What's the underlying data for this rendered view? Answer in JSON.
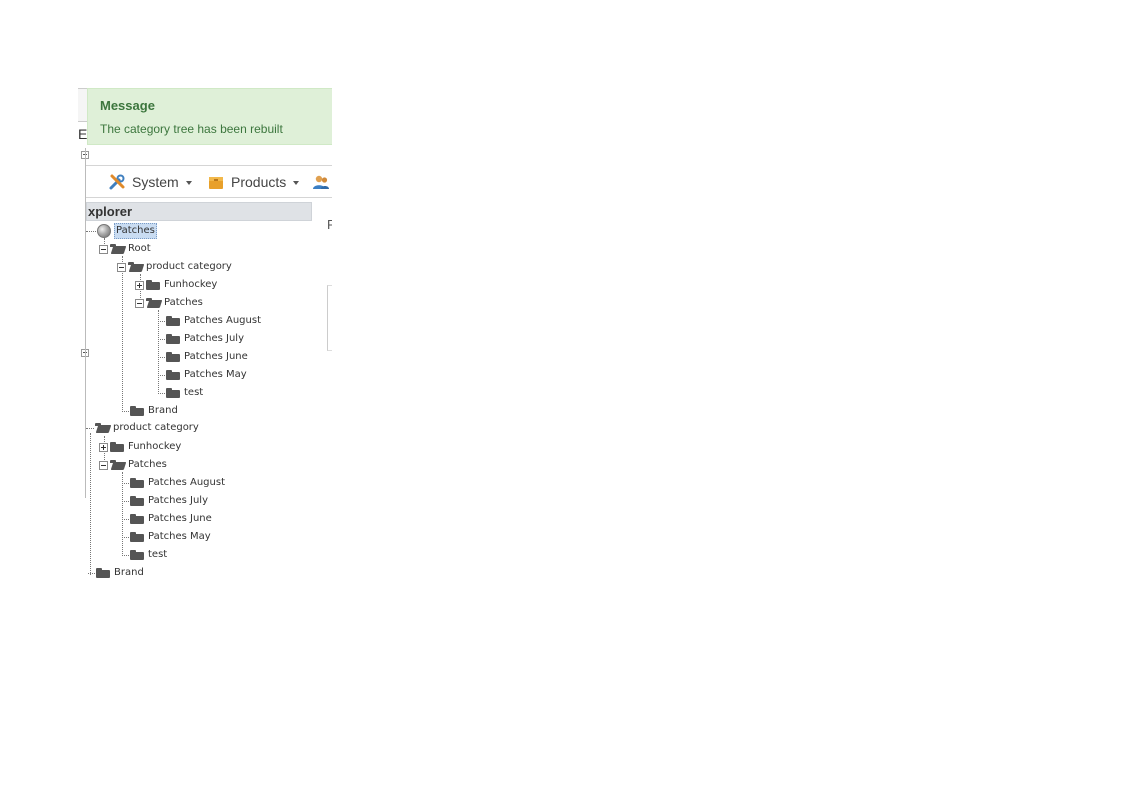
{
  "message": {
    "title": "Message",
    "text": "The category tree has been rebuilt"
  },
  "toolbar": {
    "items": [
      {
        "label": "System",
        "icon": "tools-icon"
      },
      {
        "label": "Products",
        "icon": "box-icon"
      },
      {
        "label": "",
        "icon": "users-icon"
      }
    ]
  },
  "fragments": {
    "left_letter": "E",
    "right_letter": "F"
  },
  "explorer": {
    "title": "xplorer",
    "root_label": "Patches",
    "tree": {
      "root": "Root",
      "product_category": "product category",
      "funhockey": "Funhockey",
      "patches": "Patches",
      "patches_august": "Patches August",
      "patches_july": "Patches July",
      "patches_june": "Patches June",
      "patches_may": "Patches May",
      "test": "test",
      "brand": "Brand"
    }
  },
  "drag_tree": {
    "product_category": "product category",
    "funhockey": "Funhockey",
    "patches": "Patches",
    "patches_august": "Patches August",
    "patches_july": "Patches July",
    "patches_june": "Patches June",
    "patches_may": "Patches May",
    "test": "test",
    "brand": "Brand"
  },
  "colors": {
    "message_bg": "#dff0d8",
    "message_text": "#3c763d",
    "selection": "#c9dcf2"
  }
}
